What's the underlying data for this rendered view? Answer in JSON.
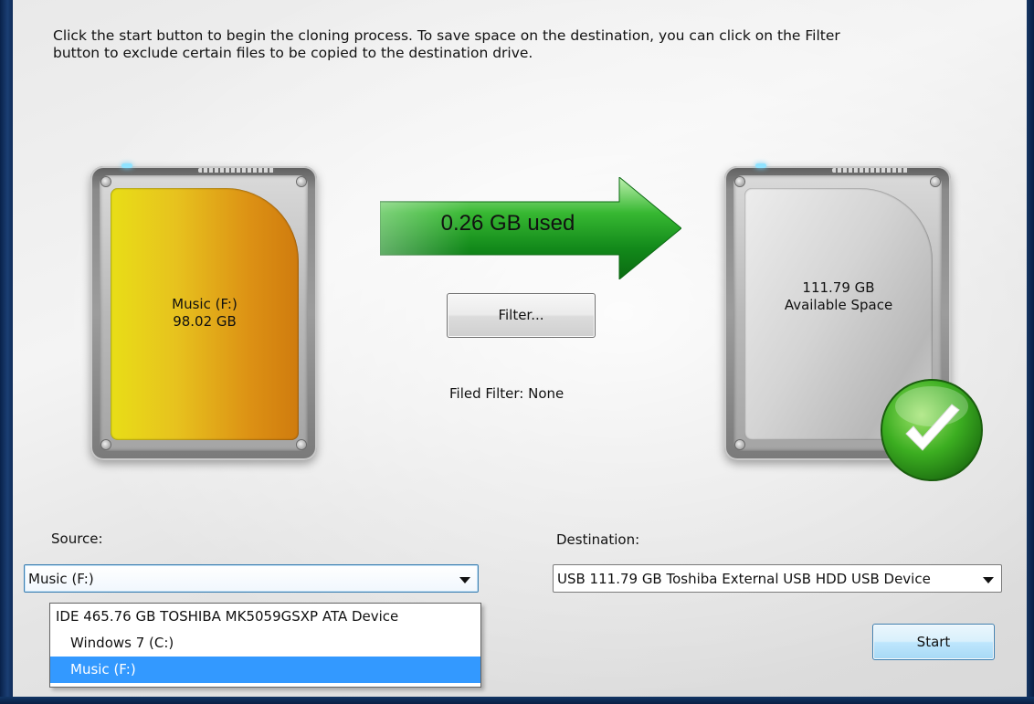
{
  "instructions": "Click the start button to begin the cloning process. To save space on the destination, you can click on the Filter\nbutton to exclude certain files to be copied to the destination drive.",
  "source_drive": {
    "name": "Music (F:)",
    "size": "98.02 GB"
  },
  "transfer": {
    "used_label": "0.26 GB used"
  },
  "filter": {
    "button_label": "Filter...",
    "status": "Filed Filter: None"
  },
  "destination_drive": {
    "space": "111.79 GB",
    "space_label": "Available Space"
  },
  "source": {
    "label": "Source:",
    "selected": "Music (F:)",
    "options": [
      {
        "label": "IDE 465.76 GB TOSHIBA MK5059GSXP ATA Device"
      },
      {
        "label": "Windows 7 (C:)"
      },
      {
        "label": "Music (F:)"
      }
    ]
  },
  "destination": {
    "label": "Destination:",
    "selected": "USB 111.79 GB Toshiba External USB HDD USB Device"
  },
  "start_button": {
    "label": "Start"
  },
  "colors": {
    "source_drive_gradient": [
      "#e8de17",
      "#cf7b0e"
    ],
    "arrow_green": "#1c9a1f",
    "selection_blue": "#3399ff",
    "check_green": "#3cae21"
  },
  "icons": [
    "hard-drive-icon",
    "arrow-right-icon",
    "checkmark-icon",
    "chevron-down-icon"
  ]
}
